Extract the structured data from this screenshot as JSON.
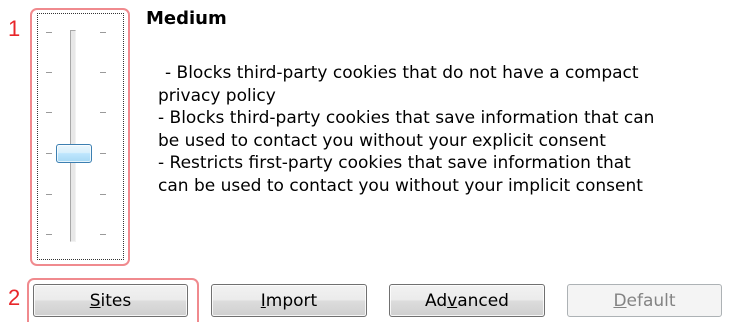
{
  "annotations": {
    "marker1": "1",
    "marker2": "2"
  },
  "privacy_slider": {
    "level_title": "Medium",
    "description_lines": [
      "- Blocks third-party cookies that do not have a compact",
      "privacy policy",
      "- Blocks third-party cookies that save information that can",
      "be used to contact you without your explicit consent",
      "- Restricts first-party cookies that save information that",
      "can be used to contact you without your implicit consent"
    ],
    "thumb_icon": "slider-thumb",
    "level_fraction": 0.5
  },
  "buttons": {
    "sites": {
      "label_pre": "",
      "label_mnemonic": "S",
      "label_post": "ites",
      "enabled": true
    },
    "import": {
      "label_pre": "",
      "label_mnemonic": "I",
      "label_post": "mport",
      "enabled": true
    },
    "advanced": {
      "label_pre": "Ad",
      "label_mnemonic": "v",
      "label_post": "anced",
      "enabled": true
    },
    "default": {
      "label_pre": "",
      "label_mnemonic": "D",
      "label_post": "efault",
      "enabled": false
    }
  },
  "colors": {
    "annotation": "#e8262a",
    "callout_border": "#f08a8e",
    "thumb_border": "#3c7fb1"
  }
}
